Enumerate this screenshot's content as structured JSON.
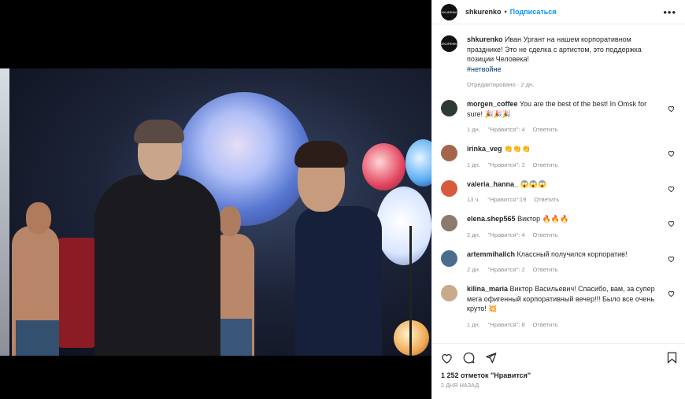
{
  "post": {
    "username": "shkurenko",
    "separator": "•",
    "follow_label": "Подписаться",
    "more_label": "•••",
    "avatar_text": "SHKURENKO",
    "caption": {
      "username": "shkurenko",
      "text": "Иван Ургант на нашем корпоративном празднике! Это не сделка с артистом, это поддержка позиции Человека!",
      "hashtag": "#нетвойне",
      "meta": "Отредактировано · 2 дн."
    }
  },
  "comments": [
    {
      "username": "morgen_coffee",
      "text": "You are the best of the best! In Omsk for sure! 🎉🎉🎉",
      "time": "1 дн.",
      "likes": "\"Нравится\": 4",
      "reply": "Ответить",
      "avatar_color": "#2e3b33"
    },
    {
      "username": "irinka_veg",
      "text": "👏👏👏",
      "time": "1 дн.",
      "likes": "\"Нравится\": 2",
      "reply": "Ответить",
      "avatar_color": "#a4664a"
    },
    {
      "username": "valeria_hanna_",
      "text": "😱😱😱",
      "time": "13 ч.",
      "likes": "\"Нравится\":19",
      "reply": "Ответить",
      "avatar_color": "#d65a3b"
    },
    {
      "username": "elena.shep565",
      "text": "Виктор 🔥🔥🔥",
      "time": "2 дн.",
      "likes": "\"Нравится\": 4",
      "reply": "Ответить",
      "avatar_color": "#8c7a6a"
    },
    {
      "username": "artemmihalich",
      "text": "Классный получился корпоратив!",
      "time": "2 дн.",
      "likes": "\"Нравится\": 2",
      "reply": "Ответить",
      "avatar_color": "#4a6c8f"
    },
    {
      "username": "kilina_maria",
      "text": "Виктор Васильевич! Спасибо, вам, за супер мега офигенный корпоративный вечер!!! Было все очень круто! 💥",
      "time": "1 дн.",
      "likes": "\"Нравится\": 8",
      "reply": "Ответить",
      "avatar_color": "#c8a98a"
    }
  ],
  "actions": {
    "likes_count": "1 252 отметок \"Нравится\"",
    "posted_ago": "2 ДНЯ НАЗАД"
  },
  "icons": [
    "heart-icon",
    "comment-icon",
    "share-icon",
    "bookmark-icon",
    "more-icon"
  ]
}
